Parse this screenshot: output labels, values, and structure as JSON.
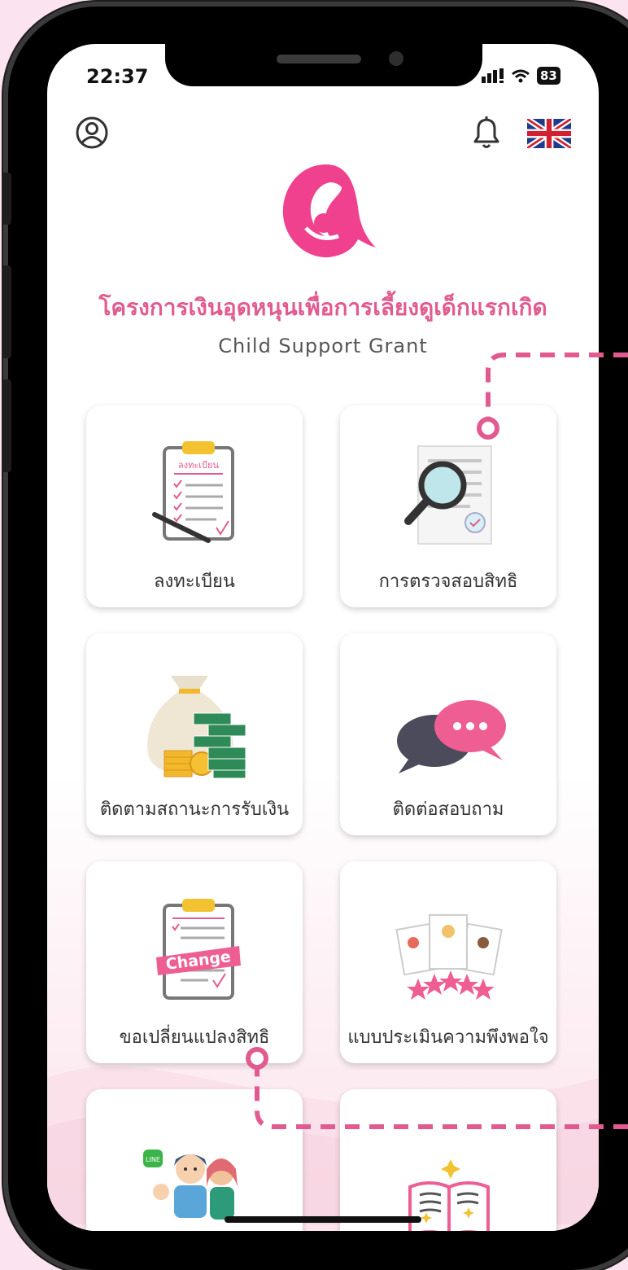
{
  "status_bar": {
    "time": "22:37",
    "battery": "83"
  },
  "header": {
    "profile_icon": "user-circle-icon",
    "notification_icon": "bell-icon",
    "language_icon": "uk-flag-icon"
  },
  "app": {
    "title_th": "โครงการเงินอุดหนุนเพื่อการเลี้ยงดูเด็กแรกเกิด",
    "title_en": "Child Support Grant"
  },
  "menu": [
    {
      "label": "ลงทะเบียน",
      "icon": "clipboard-register-icon"
    },
    {
      "label": "การตรวจสอบสิทธิ",
      "icon": "document-magnifier-icon"
    },
    {
      "label": "ติดตามสถานะการรับเงิน",
      "icon": "money-bag-icon"
    },
    {
      "label": "ติดต่อสอบถาม",
      "icon": "chat-bubbles-icon"
    },
    {
      "label": "ขอเปลี่ยนแปลงสิทธิ",
      "icon": "clipboard-change-icon",
      "badge": "Change"
    },
    {
      "label": "แบบประเมินความพึงพอใจ",
      "icon": "rating-stars-icon"
    },
    {
      "label": "",
      "icon": "family-line-icon"
    },
    {
      "label": "",
      "icon": "open-book-icon"
    }
  ],
  "colors": {
    "brand_pink": "#e25b90",
    "pink_dark": "#f03e8e"
  }
}
